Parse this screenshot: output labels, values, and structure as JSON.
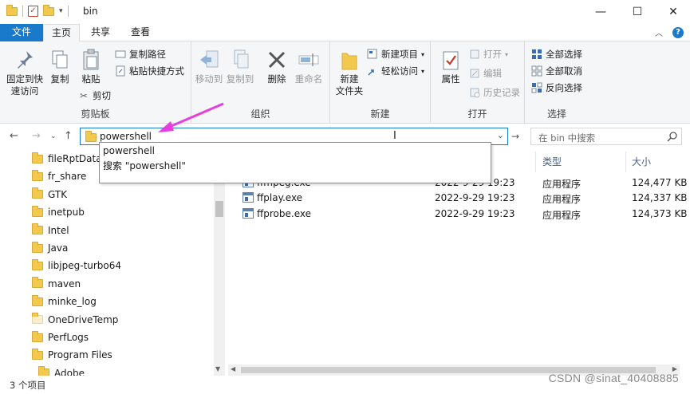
{
  "window": {
    "title": "bin",
    "controls": {
      "minimize": "—",
      "maximize": "☐",
      "close": "✕"
    }
  },
  "ribbon_tabs": [
    "文件",
    "主页",
    "共享",
    "查看"
  ],
  "ribbon": {
    "clipboard": {
      "label": "剪贴板",
      "pin": "固定到快\n速访问",
      "pin_l1": "固定到快",
      "pin_l2": "速访问",
      "copy": "复制",
      "paste": "粘贴",
      "copy_path": "复制路径",
      "paste_shortcut": "粘贴快捷方式",
      "cut": "剪切"
    },
    "organize": {
      "label": "组织",
      "move_to": "移动到",
      "copy_to": "复制到",
      "delete": "删除",
      "rename": "重命名"
    },
    "new": {
      "label": "新建",
      "new_folder_l1": "新建",
      "new_folder_l2": "文件夹",
      "new_item": "新建项目",
      "easy_access": "轻松访问"
    },
    "open": {
      "label": "打开",
      "properties": "属性",
      "open": "打开",
      "edit": "编辑",
      "history": "历史记录"
    },
    "select": {
      "label": "选择",
      "select_all": "全部选择",
      "select_none": "全部取消",
      "invert": "反向选择"
    }
  },
  "address": {
    "value": "powershell",
    "search_placeholder": "在 bin 中搜索"
  },
  "autocomplete": {
    "item1": "powershell",
    "item2": "搜索 \"powershell\""
  },
  "tree": [
    "fileRptData",
    "fr_share",
    "GTK",
    "inetpub",
    "Intel",
    "Java",
    "libjpeg-turbo64",
    "maven",
    "minke_log",
    "OneDriveTemp",
    "PerfLogs",
    "Program Files",
    "Adobe"
  ],
  "list": {
    "columns": {
      "type": "类型",
      "size": "大小"
    },
    "rows": [
      {
        "name": "ffmpeg.exe",
        "date": "2022-9-29 19:23",
        "type": "应用程序",
        "size": "124,477 KB"
      },
      {
        "name": "ffplay.exe",
        "date": "2022-9-29 19:23",
        "type": "应用程序",
        "size": "124,337 KB"
      },
      {
        "name": "ffprobe.exe",
        "date": "2022-9-29 19:23",
        "type": "应用程序",
        "size": "124,373 KB"
      }
    ]
  },
  "status": {
    "count": "3 个项目",
    "watermark": "CSDN @sinat_40408885"
  },
  "colors": {
    "accent": "#1979ca",
    "folder": "#f2c94c",
    "annotation": "#e83ee0"
  }
}
